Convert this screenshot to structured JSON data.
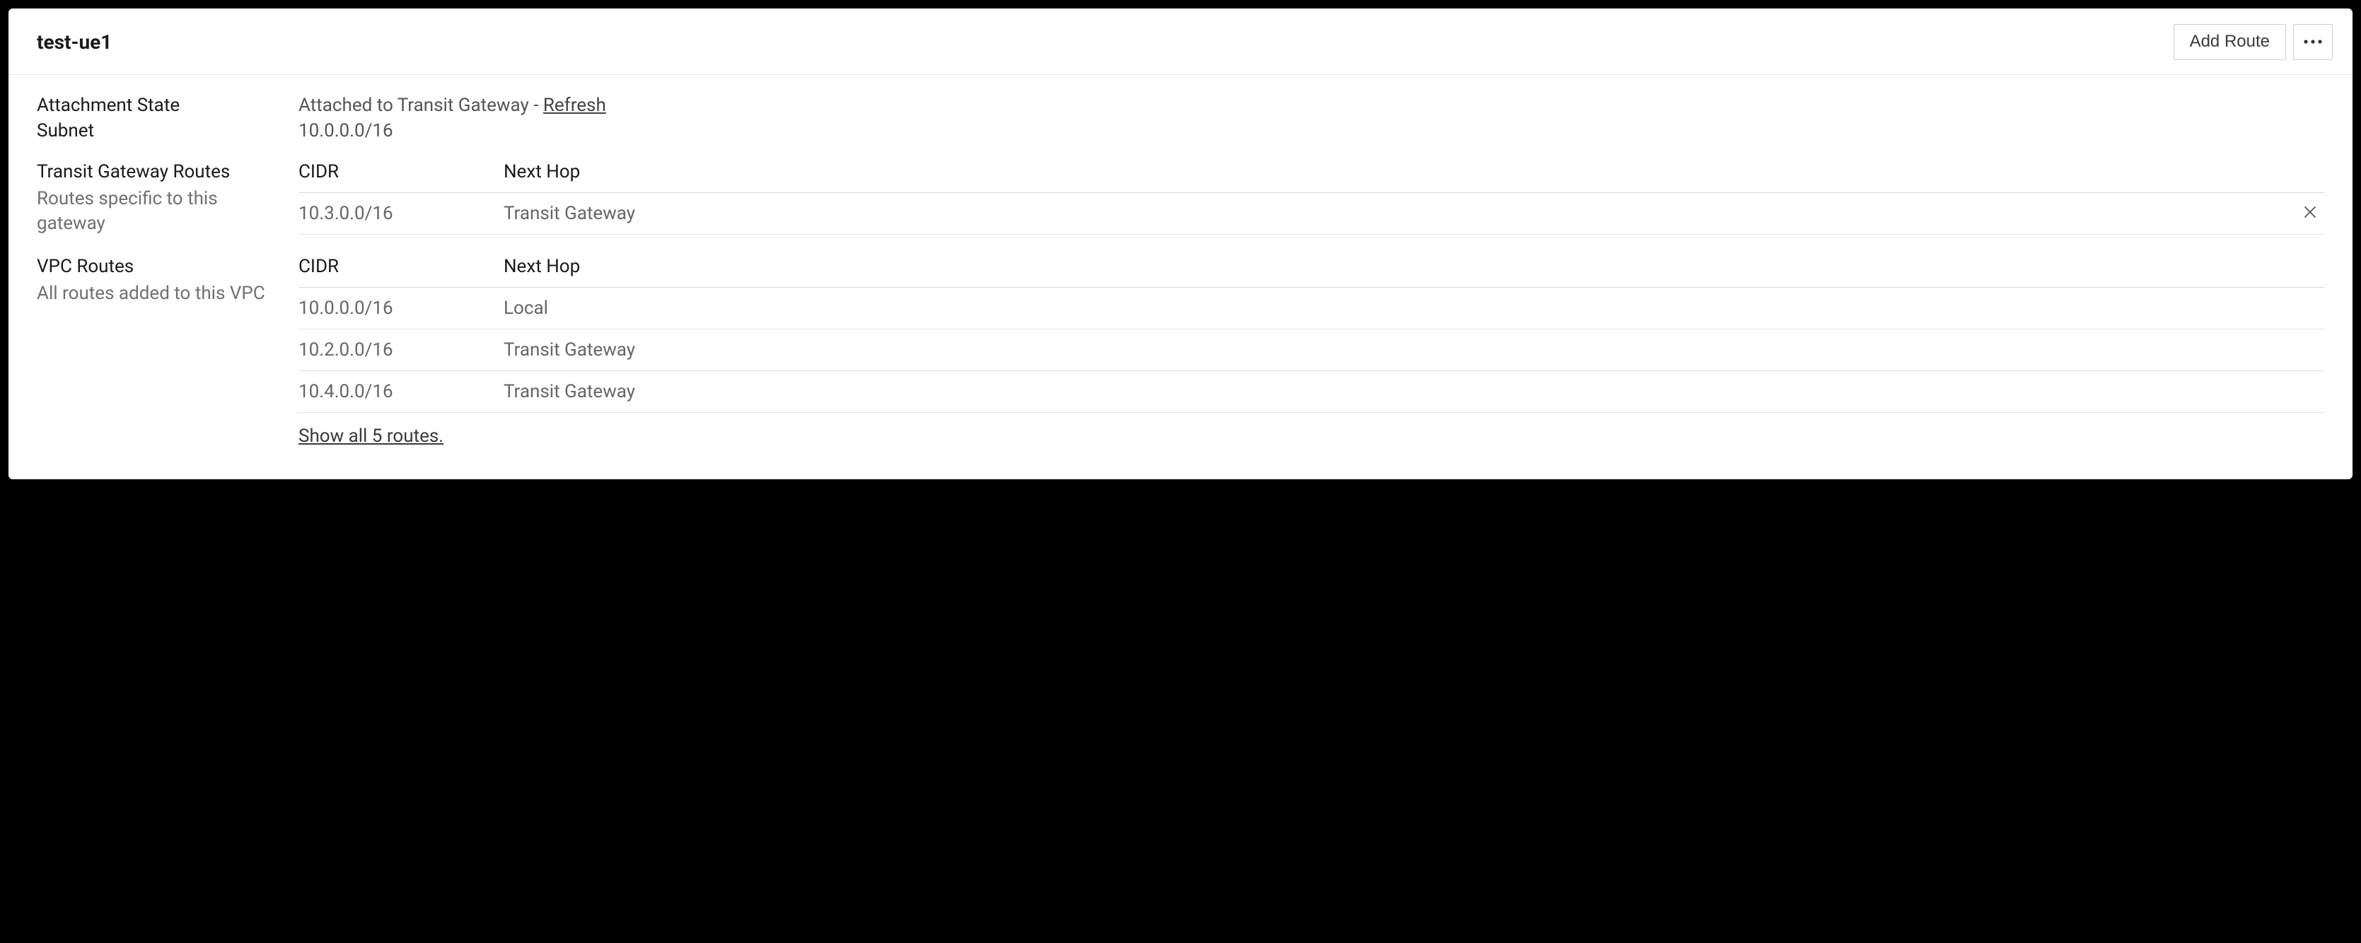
{
  "header": {
    "title": "test-ue1",
    "add_route_label": "Add Route"
  },
  "attachment": {
    "label": "Attachment State",
    "value_prefix": "Attached to Transit Gateway - ",
    "refresh_label": "Refresh"
  },
  "subnet": {
    "label": "Subnet",
    "value": "10.0.0.0/16"
  },
  "tgw_routes": {
    "label": "Transit Gateway Routes",
    "sublabel": "Routes specific to this gateway",
    "columns": {
      "cidr": "CIDR",
      "hop": "Next Hop"
    },
    "rows": [
      {
        "cidr": "10.3.0.0/16",
        "hop": "Transit Gateway",
        "deletable": true
      }
    ]
  },
  "vpc_routes": {
    "label": "VPC Routes",
    "sublabel": "All routes added to this VPC",
    "columns": {
      "cidr": "CIDR",
      "hop": "Next Hop"
    },
    "rows": [
      {
        "cidr": "10.0.0.0/16",
        "hop": "Local"
      },
      {
        "cidr": "10.2.0.0/16",
        "hop": "Transit Gateway"
      },
      {
        "cidr": "10.4.0.0/16",
        "hop": "Transit Gateway"
      }
    ],
    "show_all": "Show all 5 routes."
  }
}
